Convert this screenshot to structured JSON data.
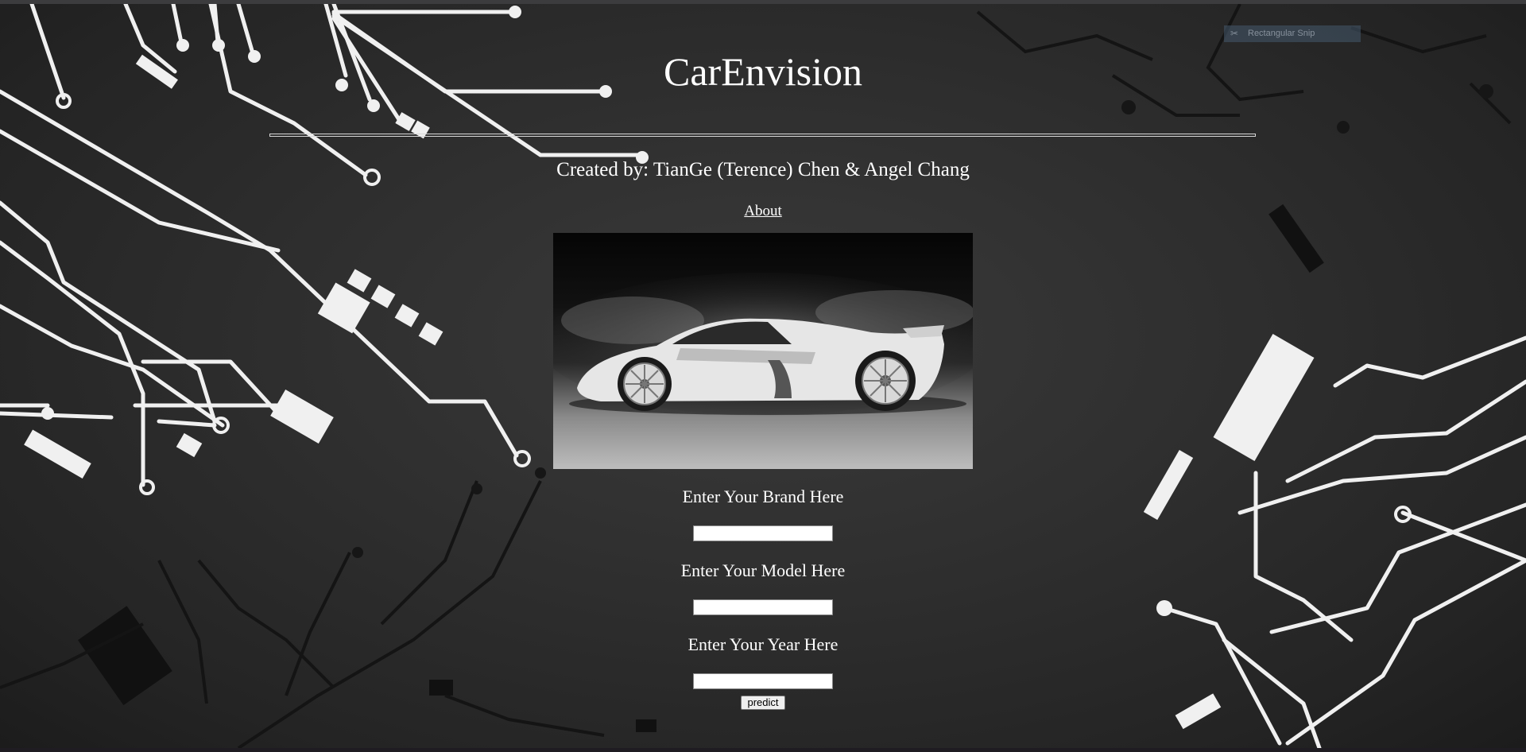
{
  "page": {
    "title": "CarEnvision",
    "credits": "Created by: TianGe (Terence) Chen & Angel Chang",
    "about_link": "About"
  },
  "hero_image": {
    "icon": "sports-car-image"
  },
  "form": {
    "brand_label": "Enter Your Brand Here",
    "brand_value": "",
    "model_label": "Enter Your Model Here",
    "model_value": "",
    "year_label": "Enter Your Year Here",
    "year_value": "",
    "predict_label": "predict"
  },
  "overlay": {
    "snip_label": "Rectangular Snip"
  },
  "colors": {
    "background": "#2e2e2e",
    "text": "#ffffff",
    "circuit": "#f2f2f2"
  }
}
